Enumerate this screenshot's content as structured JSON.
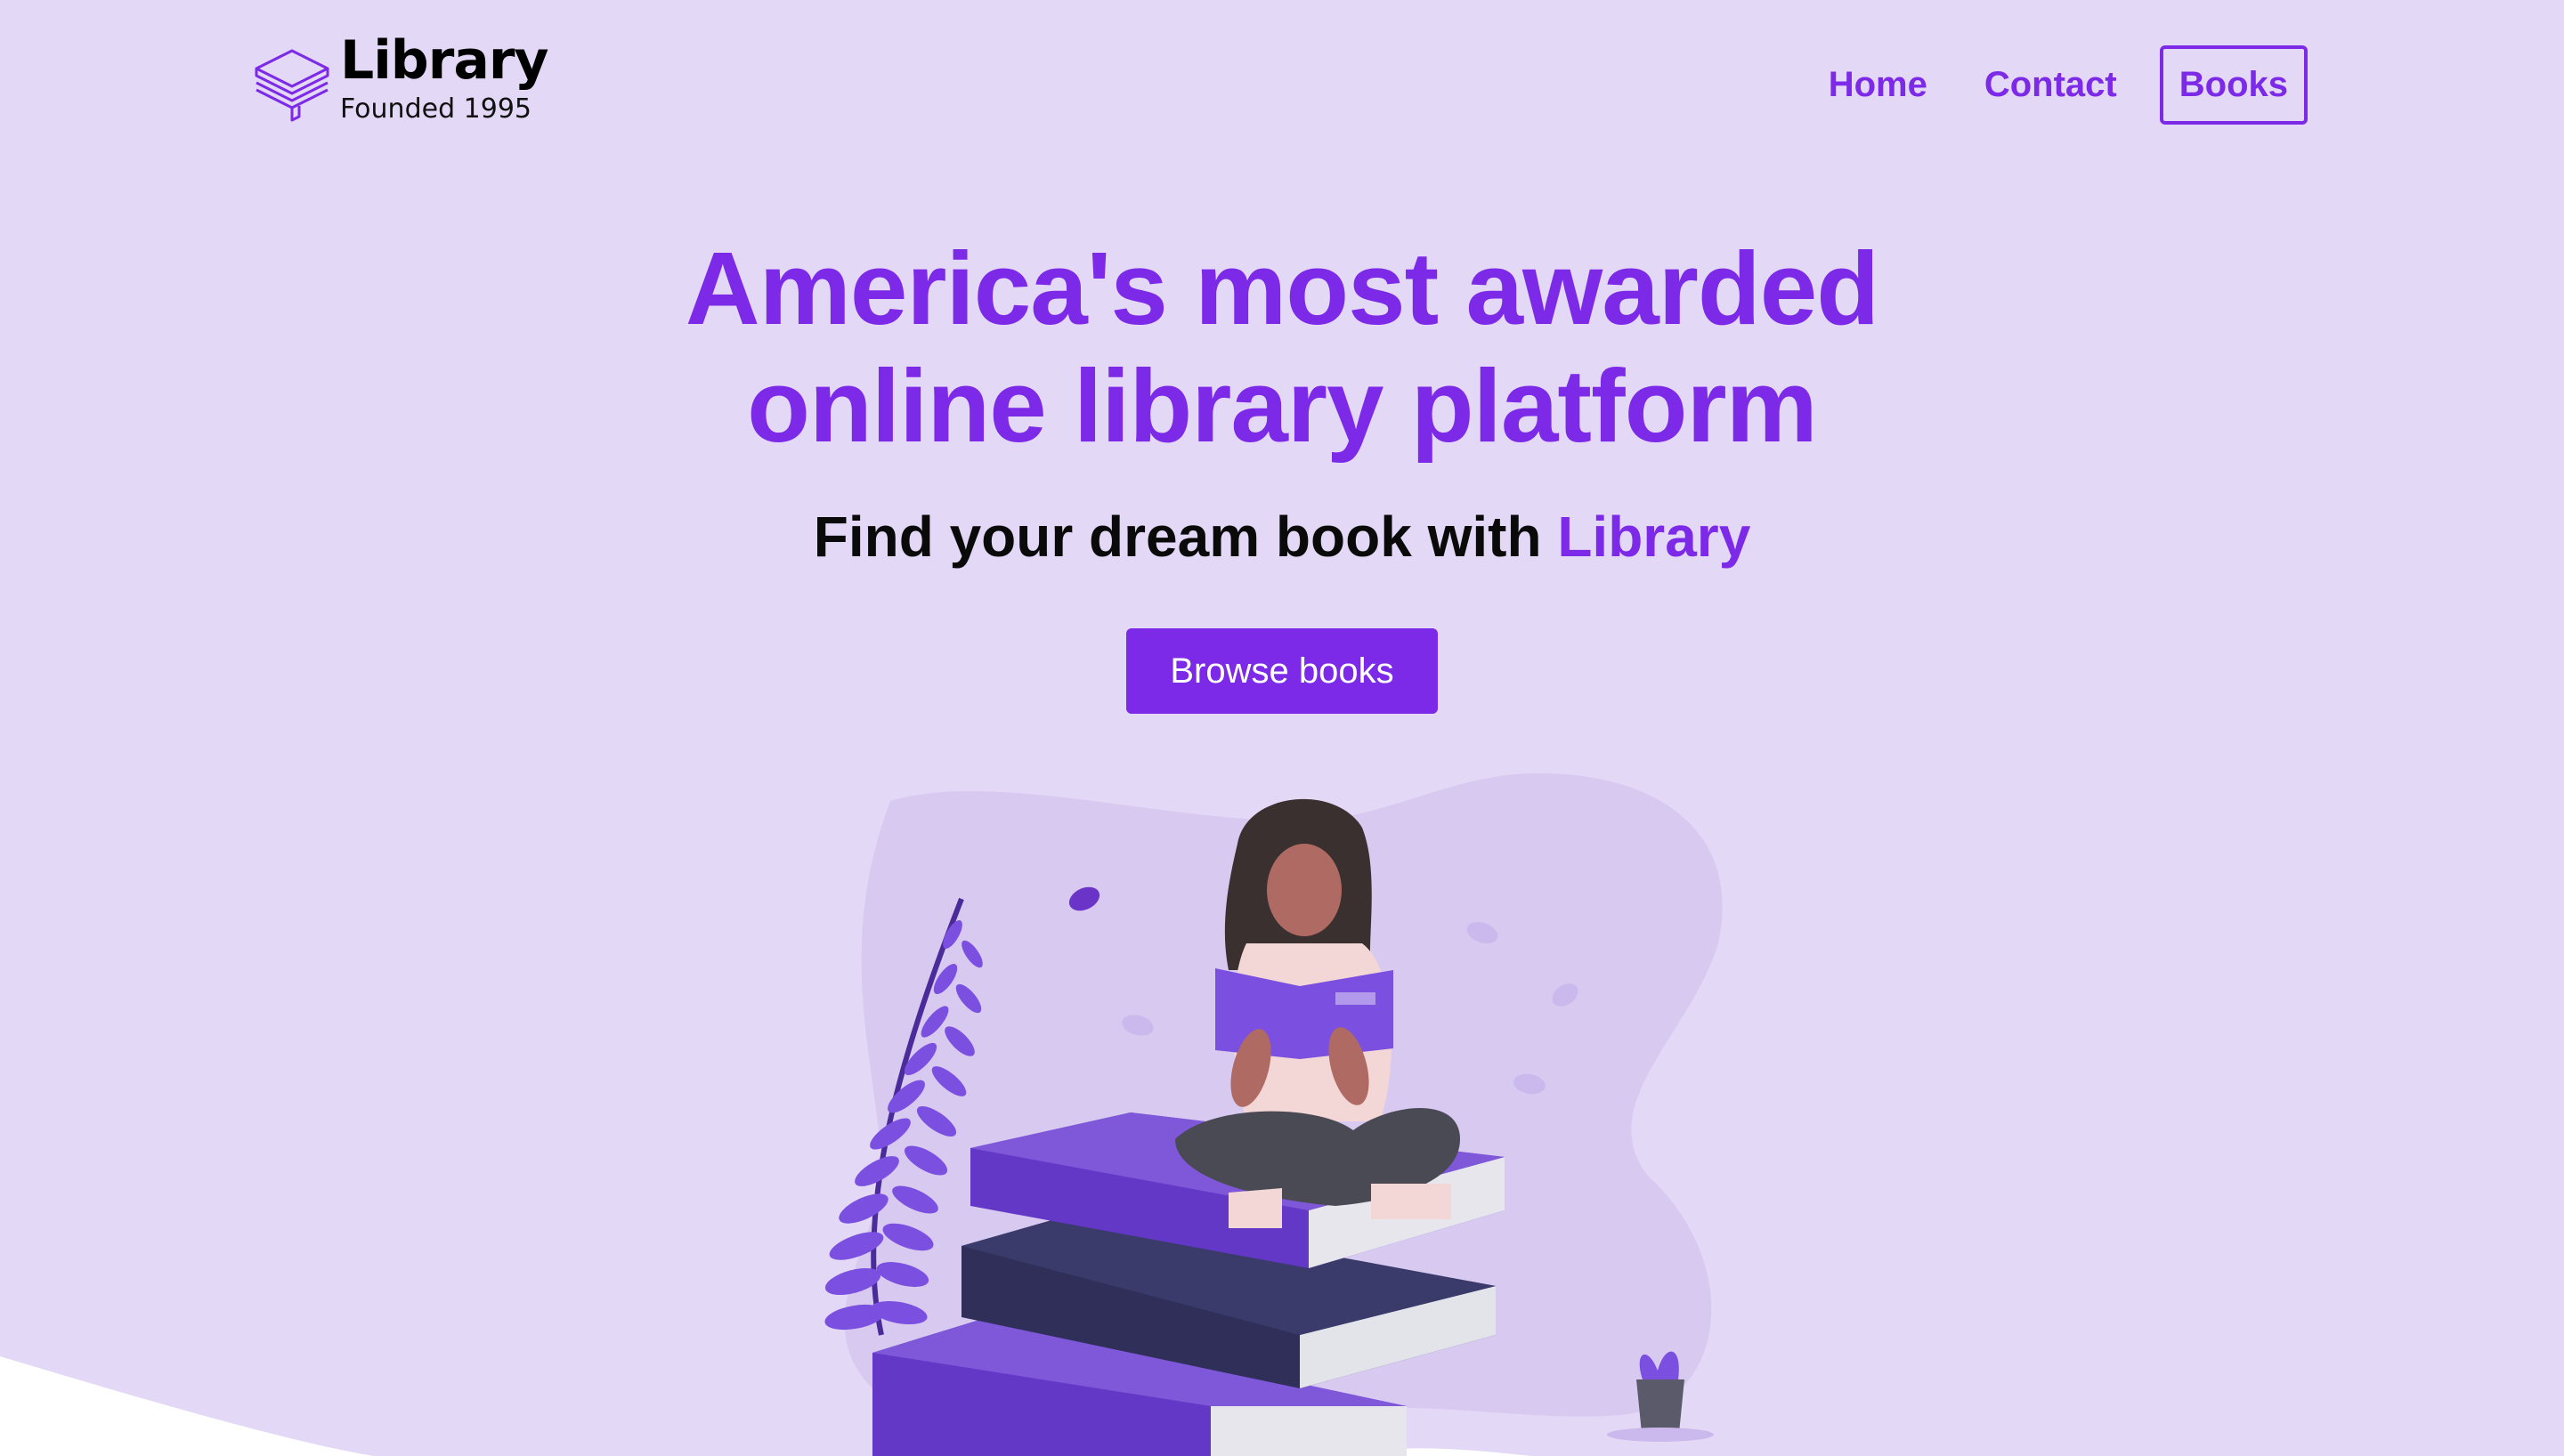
{
  "brand": {
    "title": "Library",
    "subtitle": "Founded 1995",
    "icon": "stacked-books-icon"
  },
  "nav": {
    "items": [
      {
        "label": "Home",
        "active": false
      },
      {
        "label": "Contact",
        "active": false
      },
      {
        "label": "Books",
        "active": true
      }
    ]
  },
  "hero": {
    "title_line1": "America's most awarded",
    "title_line2": "online library platform",
    "subtitle_prefix": "Find your dream book with ",
    "subtitle_accent": "Library",
    "cta_label": "Browse books"
  },
  "colors": {
    "background": "#e3d8f6",
    "accent": "#7c2ae8",
    "blob": "#d8c9f1",
    "white_wave": "#ffffff"
  },
  "illustration": {
    "icon": "woman-reading-on-books-illustration"
  }
}
